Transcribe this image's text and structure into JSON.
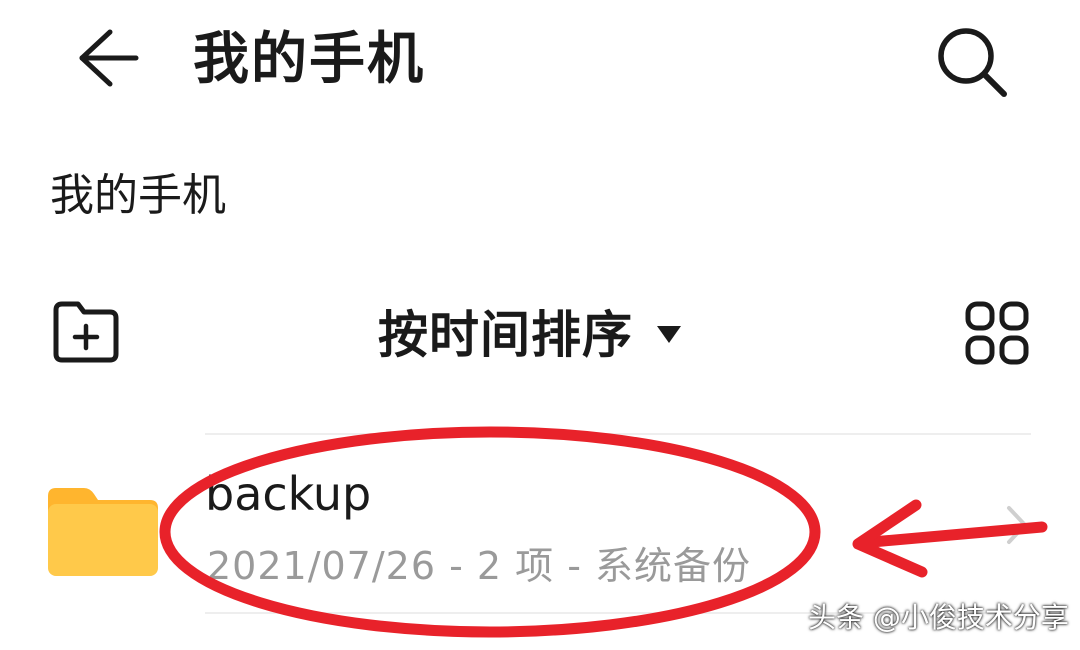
{
  "header": {
    "title": "我的手机",
    "back_icon": "arrow-left-icon",
    "search_icon": "search-icon"
  },
  "breadcrumb": {
    "path": "我的手机"
  },
  "toolbar": {
    "new_folder_icon": "folder-plus-icon",
    "sort_label": "按时间排序",
    "sort_caret_icon": "caret-down-icon",
    "grid_view_icon": "grid-view-icon"
  },
  "files": [
    {
      "name": "backup",
      "meta": "2021/07/26 - 2 项 - 系统备份",
      "icon": "folder-icon",
      "chevron_icon": "chevron-right-icon"
    }
  ],
  "annotation": {
    "highlight_color": "#e8222a"
  },
  "watermark": {
    "text": "头条 @小俊技术分享"
  },
  "colors": {
    "folder_yellow": "#ffc94a",
    "folder_tab": "#ffb52e",
    "meta_gray": "#9a9a9a"
  }
}
